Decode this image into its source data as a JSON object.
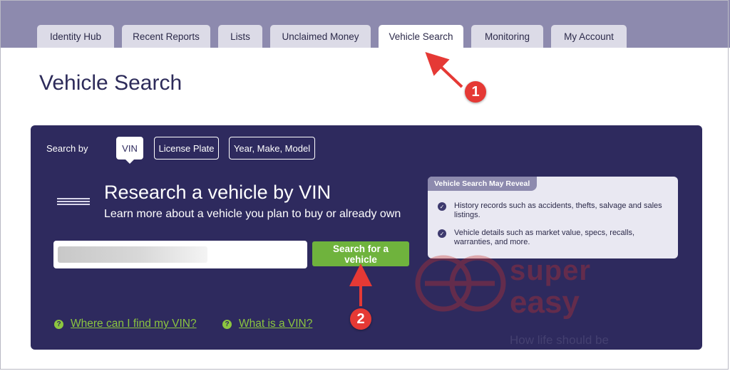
{
  "nav": {
    "tabs": [
      {
        "label": "Identity Hub"
      },
      {
        "label": "Recent Reports"
      },
      {
        "label": "Lists"
      },
      {
        "label": "Unclaimed Money"
      },
      {
        "label": "Vehicle Search",
        "active": true
      },
      {
        "label": "Monitoring"
      },
      {
        "label": "My Account"
      }
    ]
  },
  "page": {
    "title": "Vehicle Search"
  },
  "search": {
    "search_by_label": "Search by",
    "modes": [
      {
        "label": "VIN",
        "active": true
      },
      {
        "label": "License Plate"
      },
      {
        "label": "Year, Make, Model"
      }
    ],
    "heading": "Research a vehicle by VIN",
    "subheading": "Learn more about a vehicle you plan to buy or already own",
    "vin_input": {
      "value": "",
      "placeholder": ""
    },
    "submit_label": "Search for a vehicle",
    "help_links": [
      {
        "label": "Where can I find my VIN?",
        "icon": "?"
      },
      {
        "label": "What is a VIN?",
        "icon": "?"
      }
    ]
  },
  "reveal": {
    "title": "Vehicle Search May Reveal",
    "items": [
      "History records such as accidents, thefts, salvage and sales listings.",
      "Vehicle details such as market value, specs, recalls, warranties, and more."
    ]
  },
  "watermark": {
    "line1": "super",
    "line2": "easy",
    "tagline": "How life should be"
  },
  "annotations": {
    "step1": "1",
    "step2": "2"
  },
  "colors": {
    "nav_bg": "#8d8aae",
    "panel_bg": "#2e2a5e",
    "accent_green": "#6fb33d",
    "link_green": "#8cc63f",
    "annotation_red": "#e53935"
  }
}
